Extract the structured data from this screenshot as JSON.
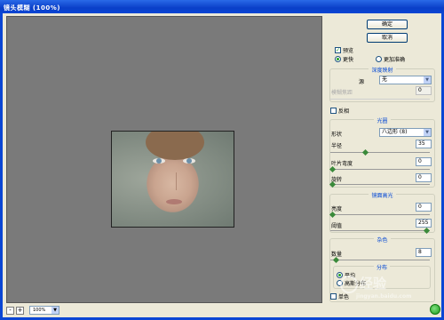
{
  "window": {
    "title": "镜头模糊 (100%)"
  },
  "buttons": {
    "ok": "确定",
    "cancel": "取消"
  },
  "preview_opts": {
    "preview_label": "预览",
    "faster_label": "更快",
    "more_accurate_label": "更加准确"
  },
  "depth_map": {
    "title": "深度映射",
    "source_label": "源",
    "source_value": "无",
    "blur_focal_label": "模糊焦距",
    "blur_focal_value": "0",
    "invert_label": "反相"
  },
  "iris": {
    "title": "光圈",
    "shape_label": "形状",
    "shape_value": "八边形 (8)",
    "radius_label": "半径",
    "radius_value": "35",
    "blade_curvature_label": "叶片弯度",
    "blade_curvature_value": "0",
    "rotation_label": "旋转",
    "rotation_value": "0"
  },
  "specular": {
    "title": "镜面高光",
    "brightness_label": "亮度",
    "brightness_value": "0",
    "threshold_label": "阈值",
    "threshold_value": "255"
  },
  "noise": {
    "title": "杂色",
    "amount_label": "数量",
    "amount_value": "8",
    "distribution_title": "分布",
    "uniform_label": "平均",
    "gaussian_label": "高斯分布",
    "mono_label": "单色"
  },
  "zoom": {
    "value": "100%",
    "minus": "-",
    "plus": "+"
  },
  "watermark": {
    "text": "经验",
    "site": "jingyan.baidu.com"
  },
  "sliders": {
    "radius": 0.35,
    "blade_curvature": 0,
    "rotation": 0,
    "brightness": 0,
    "threshold": 1,
    "amount": 0.04
  }
}
